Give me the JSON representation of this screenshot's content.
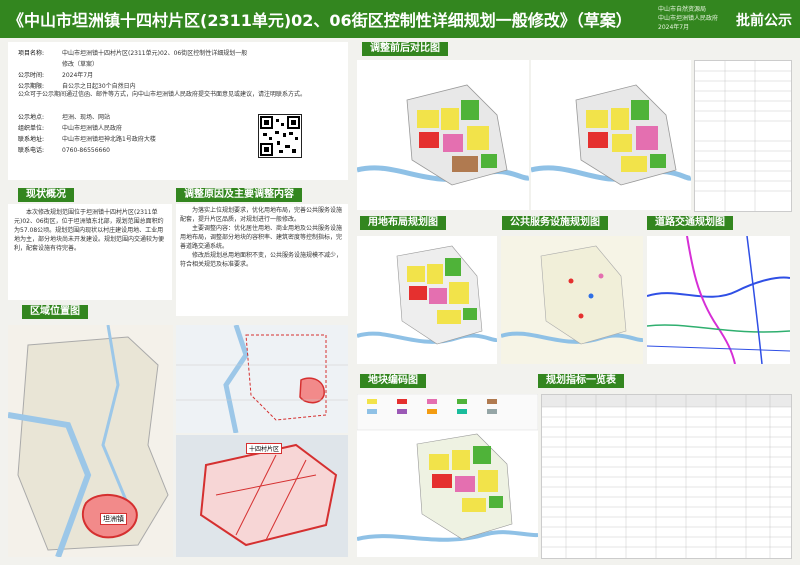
{
  "header": {
    "title": "《中山市坦洲镇十四村片区(2311单元)02、06街区控制性详细规划一般修改》（草案）",
    "org_lines": [
      "中山市自然资源局",
      "中山市坦洲镇人民政府",
      "2024年7月"
    ],
    "badge": "批前公示"
  },
  "info": {
    "rows": [
      {
        "k": "项目名称:",
        "v": "中山市坦洲镇十四村片区(2311单元)02、06街区控制性详细规划一般修改（草案）"
      },
      {
        "k": "公示时间:",
        "v": "2024年7月"
      },
      {
        "k": "公示期限:",
        "v": "自公示之日起30个自然日内"
      }
    ],
    "desc": "公众可于公示期间通过信函、邮件等方式，向中山市坦洲镇人民政府提交书面意见或建议，请注明联系方式。",
    "contact_rows": [
      {
        "k": "公示地点:",
        "v": "坦洲、现场、网站"
      },
      {
        "k": "组织单位:",
        "v": "中山市坦洲镇人民政府"
      },
      {
        "k": "联系地址:",
        "v": "中山市坦洲镇坦神北路1号政府大楼"
      },
      {
        "k": "联系电话:",
        "v": "0760-86556660"
      }
    ]
  },
  "sections": {
    "status": "现状概况",
    "reason": "调整原因及主要调整内容",
    "location": "区域位置图",
    "compare": "调整前后对比图",
    "landuse": "用地布局规划图",
    "public": "公共服务设施规划图",
    "road": "道路交通规划图",
    "plot": "地块编码图",
    "index": "规划指标一览表"
  },
  "status_text": "本次修改规划范围位于坦洲镇十四村片区(2311单元)02、06街区，位于坦洲镇东北部，规划范围总面积约为57.08公顷。规划范围内现状以村庄建设用地、工业用地为主，部分地块尚未开发建设。规划范围内交通较为便利，配套设施有待完善。",
  "reason_text": [
    "为落实上位规划要求，优化用地布局，完善公共服务设施配套，提升片区品质，对规划进行一般修改。",
    "主要调整内容：优化居住用地、商业用地及公共服务设施用地布局，调整部分地块的容积率、建筑密度等控制指标，完善道路交通系统。",
    "修改后规划总用地面积不变，公共服务设施规模不减少，符合相关规范及标准要求。"
  ],
  "location_labels": {
    "region": "坦洲镇",
    "area": "十四村片区"
  },
  "colors": {
    "header": "#33861f",
    "residential": "#f2e34a",
    "commercial": "#e5302f",
    "public": "#e46fb0",
    "green": "#4fb339",
    "industrial": "#b07a50",
    "water": "#8fc1e6"
  }
}
